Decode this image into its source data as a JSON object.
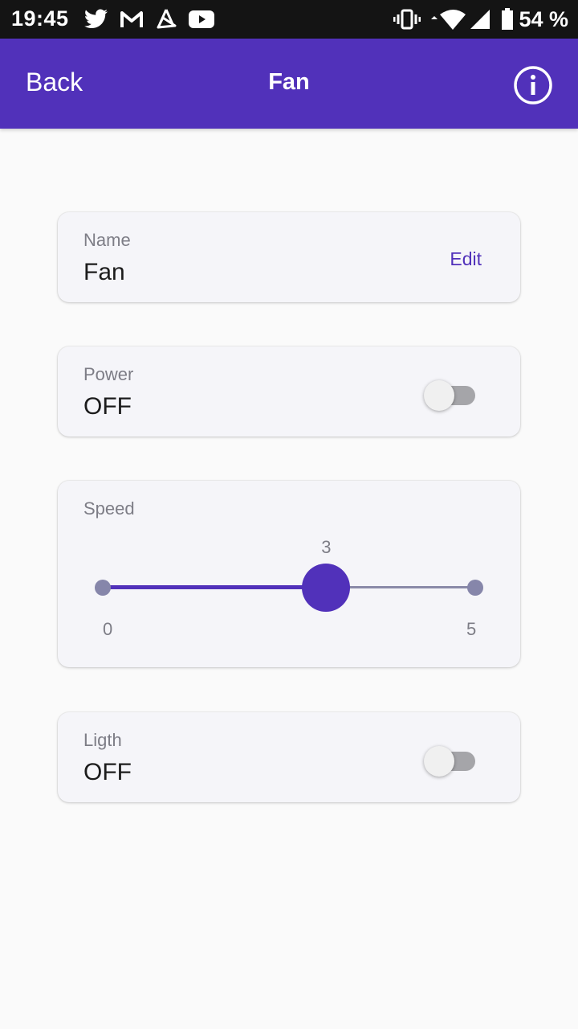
{
  "status_bar": {
    "time": "19:45",
    "battery_percent": "54 %",
    "icons": [
      "twitter-icon",
      "gmail-icon",
      "strava-icon",
      "youtube-icon",
      "vibrate-icon",
      "wifi-icon",
      "cell-signal-icon",
      "battery-icon"
    ]
  },
  "app_bar": {
    "back_label": "Back",
    "title": "Fan",
    "info_icon": "info-icon",
    "color": "#5131ba"
  },
  "name_card": {
    "label": "Name",
    "value": "Fan",
    "edit_label": "Edit"
  },
  "power_card": {
    "label": "Power",
    "value": "OFF",
    "toggle_on": false
  },
  "speed_card": {
    "label": "Speed",
    "min": "0",
    "max": "5",
    "current": "3"
  },
  "light_card": {
    "label": "Ligth",
    "value": "OFF",
    "toggle_on": false
  }
}
